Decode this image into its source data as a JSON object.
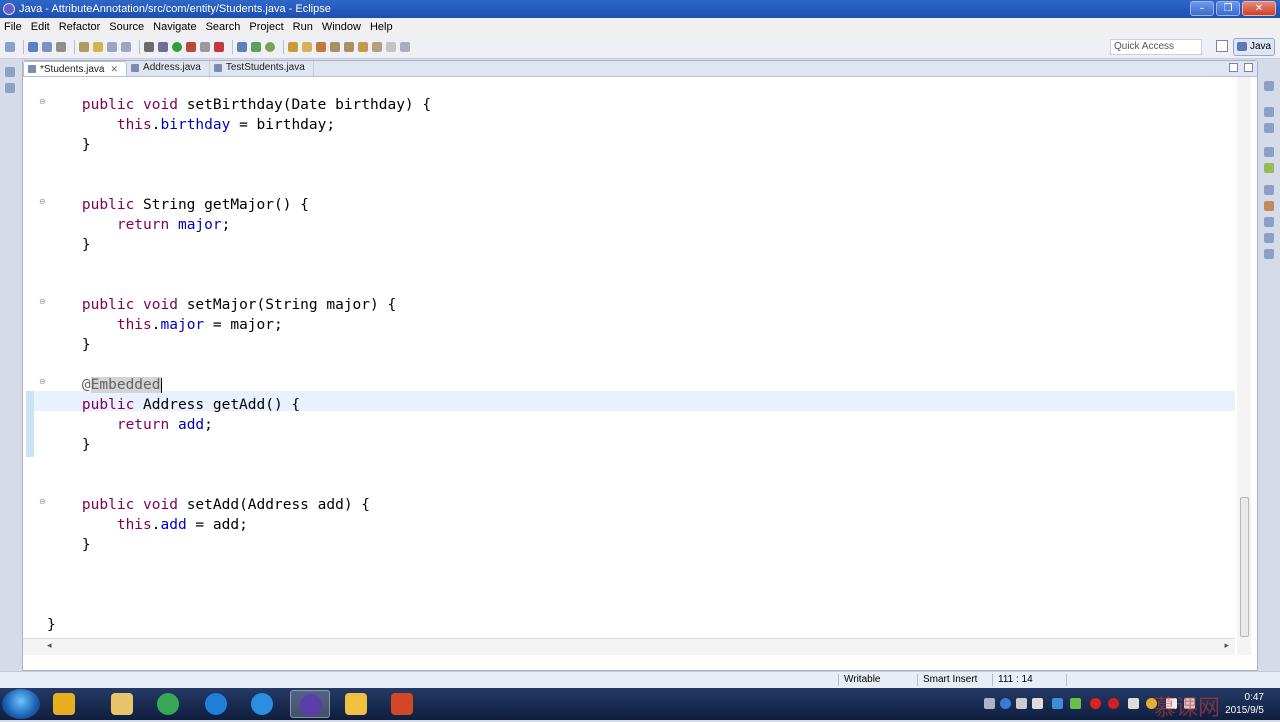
{
  "window": {
    "title": "Java - AttributeAnnotation/src/com/entity/Students.java - Eclipse"
  },
  "menu": [
    "File",
    "Edit",
    "Refactor",
    "Source",
    "Navigate",
    "Search",
    "Project",
    "Run",
    "Window",
    "Help"
  ],
  "toolbar": {
    "quick_access_placeholder": "Quick Access",
    "perspective": "Java"
  },
  "tabs": [
    {
      "label": "*Students.java",
      "active": true
    },
    {
      "label": "Address.java",
      "active": false
    },
    {
      "label": "TestStudents.java",
      "active": false
    }
  ],
  "code": {
    "set_birthday_sig": "    public void setBirthday(Date birthday) {",
    "set_birthday_body_kw": "this",
    "set_birthday_body_field": "birthday",
    "set_birthday_body_rest": " = birthday;",
    "get_major_sig": "    public String getMajor() {",
    "get_major_kw": "return",
    "get_major_field": "major",
    "set_major_sig": "    public void setMajor(String major) {",
    "set_major_field": "major",
    "set_major_rest": " = major;",
    "annotation_at": "@",
    "annotation_name": "Embedded",
    "get_add_sig": "    public Address getAdd() {",
    "get_add_field": "add",
    "set_add_sig": "    public void setAdd(Address add) {",
    "set_add_field": "add",
    "set_add_rest": " = add;",
    "close_brace": "    }",
    "class_close": "}",
    "kw_public": "public",
    "kw_void": "void",
    "semicolon": ";",
    "dot": "."
  },
  "status": {
    "writable": "Writable",
    "insert_mode": "Smart Insert",
    "position": "111 : 14"
  },
  "clock": {
    "time": "0:47",
    "date": "2015/9/5"
  },
  "watermark": "慕课网"
}
